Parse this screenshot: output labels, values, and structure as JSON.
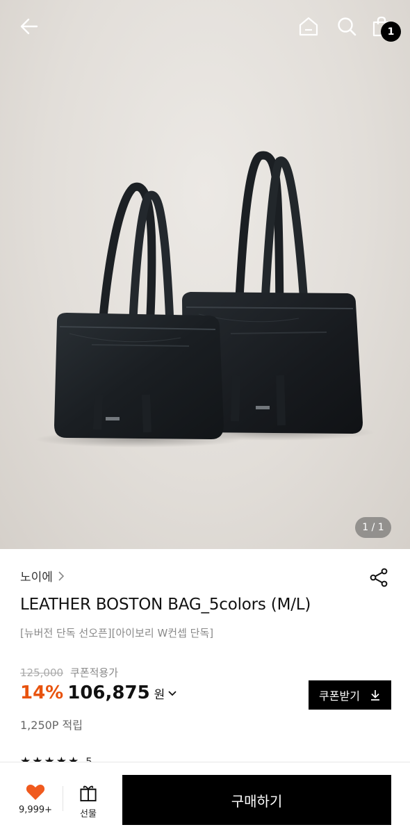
{
  "header": {
    "back_icon": "arrow-left-icon",
    "home_icon": "home-icon",
    "search_icon": "search-icon",
    "cart_icon": "shopping-bag-icon",
    "cart_count": "1"
  },
  "gallery": {
    "indicator": "1 / 1"
  },
  "product": {
    "brand": "노이에",
    "title": "LEATHER BOSTON BAG_5colors (M/L)",
    "subtitle": "[뉴버전 단독 선오픈][아이보리 W컨셉 단독]",
    "original_price": "125,000",
    "coupon_note": "쿠폰적용가",
    "discount": "14%",
    "price": "106,875",
    "currency": "원",
    "coupon_button": "쿠폰받기",
    "points": "1,250P 적립",
    "rating_stars": "★★★★★",
    "rating_value": "5"
  },
  "bottom_bar": {
    "like_count": "9,999+",
    "gift_label": "선물",
    "buy_label": "구매하기"
  },
  "colors": {
    "accent_discount": "#e8530e",
    "like_heart": "#f05a1e",
    "primary_button": "#000000"
  }
}
